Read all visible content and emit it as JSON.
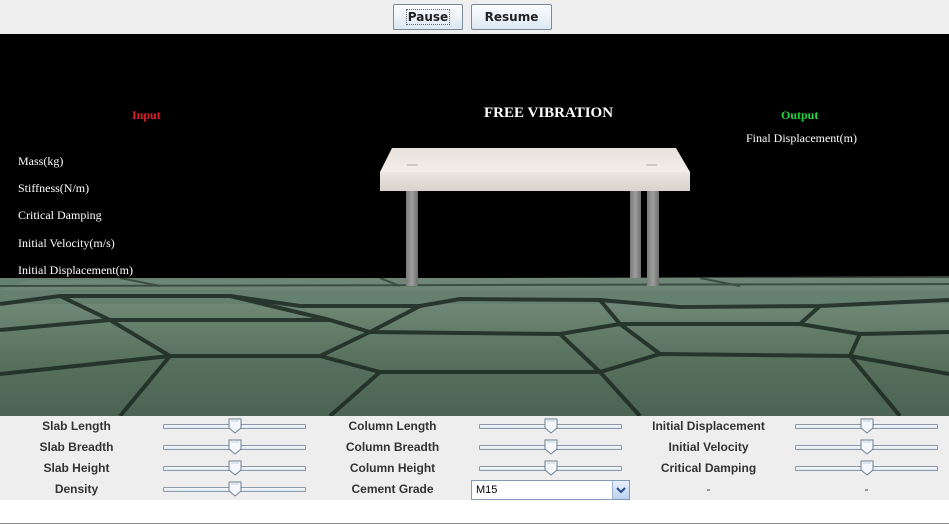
{
  "toolbar": {
    "pause_label": "Pause",
    "resume_label": "Resume"
  },
  "scene": {
    "title": "FREE VIBRATION",
    "input_heading": "Input",
    "output_heading": "Output",
    "input_labels": [
      "Mass(kg)",
      "Stiffness(N/m)",
      "Critical Damping",
      "Initial Velocity(m/s)",
      "Initial Displacement(m)"
    ],
    "output_label": "Final Displacement(m)",
    "colors": {
      "input_heading": "#e0202a",
      "output_heading": "#22d83a",
      "background": "#000000",
      "floor": "#5a7360"
    }
  },
  "controls": {
    "col1": [
      {
        "label": "Slab Length",
        "value": 0.5
      },
      {
        "label": "Slab Breadth",
        "value": 0.5
      },
      {
        "label": "Slab Height",
        "value": 0.5
      },
      {
        "label": "Density",
        "value": 0.5
      }
    ],
    "col2": [
      {
        "label": "Column Length",
        "value": 0.5
      },
      {
        "label": "Column Breadth",
        "value": 0.5
      },
      {
        "label": "Column Height",
        "value": 0.5
      }
    ],
    "col3": [
      {
        "label": "Initial Displacement",
        "value": 0.5
      },
      {
        "label": "Initial Velocity",
        "value": 0.5
      },
      {
        "label": "Critical Damping",
        "value": 0.5
      }
    ],
    "cement_grade_label": "Cement Grade",
    "cement_grade_value": "M15",
    "dash_a": "-",
    "dash_b": "-"
  }
}
